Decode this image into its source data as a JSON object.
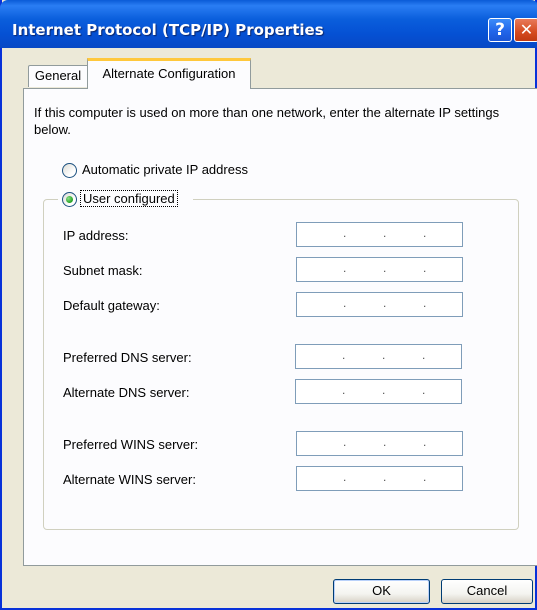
{
  "window": {
    "title": "Internet Protocol (TCP/IP) Properties",
    "help_glyph": "?",
    "close_glyph": "✕"
  },
  "tabs": [
    {
      "label": "General",
      "active": false
    },
    {
      "label": "Alternate Configuration",
      "active": true
    }
  ],
  "description": "If this computer is used on more than one network, enter the alternate IP settings below.",
  "options": {
    "automatic": {
      "label": "Automatic private IP address",
      "selected": false
    },
    "user": {
      "label": "User configured",
      "selected": true
    }
  },
  "fields": [
    {
      "label": "IP address:",
      "value": ""
    },
    {
      "label": "Subnet mask:",
      "value": ""
    },
    {
      "label": "Default gateway:",
      "value": ""
    },
    {
      "label": "Preferred DNS server:",
      "value": ""
    },
    {
      "label": "Alternate DNS server:",
      "value": ""
    },
    {
      "label": "Preferred WINS server:",
      "value": ""
    },
    {
      "label": "Alternate WINS server:",
      "value": ""
    }
  ],
  "ip_separator": ".",
  "buttons": {
    "ok": "OK",
    "cancel": "Cancel"
  },
  "colors": {
    "titlebar": "#0551d4",
    "dialog_bg": "#ece9d8",
    "active_tab_accent": "#ffc83c",
    "close_button": "#d54a1f"
  },
  "icons": [
    "help-icon",
    "close-icon",
    "radio-button-icon"
  ]
}
